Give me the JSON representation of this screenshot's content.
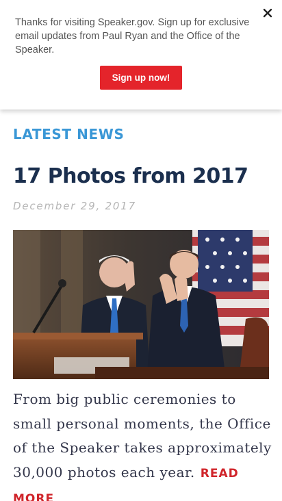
{
  "banner": {
    "message": "Thanks for visiting Speaker.gov. Sign up for exclusive email updates from Paul Ryan and the Office of the Speaker.",
    "signup_label": "Sign up now!",
    "close_icon": "close-icon",
    "button_color": "#e4242b"
  },
  "main": {
    "section_label": "LATEST NEWS",
    "article": {
      "title": "17 Photos from 2017",
      "date": "December 29, 2017",
      "excerpt": "From big public ceremonies to small personal moments, the Office of the Speaker takes approximately 30,000 photos each year.",
      "read_more_label": "READ MORE"
    }
  },
  "colors": {
    "accent_blue": "#3a97d6",
    "title_navy": "#1b2f4e",
    "read_more_red": "#d0252b",
    "date_gray": "#b5b5b5"
  }
}
